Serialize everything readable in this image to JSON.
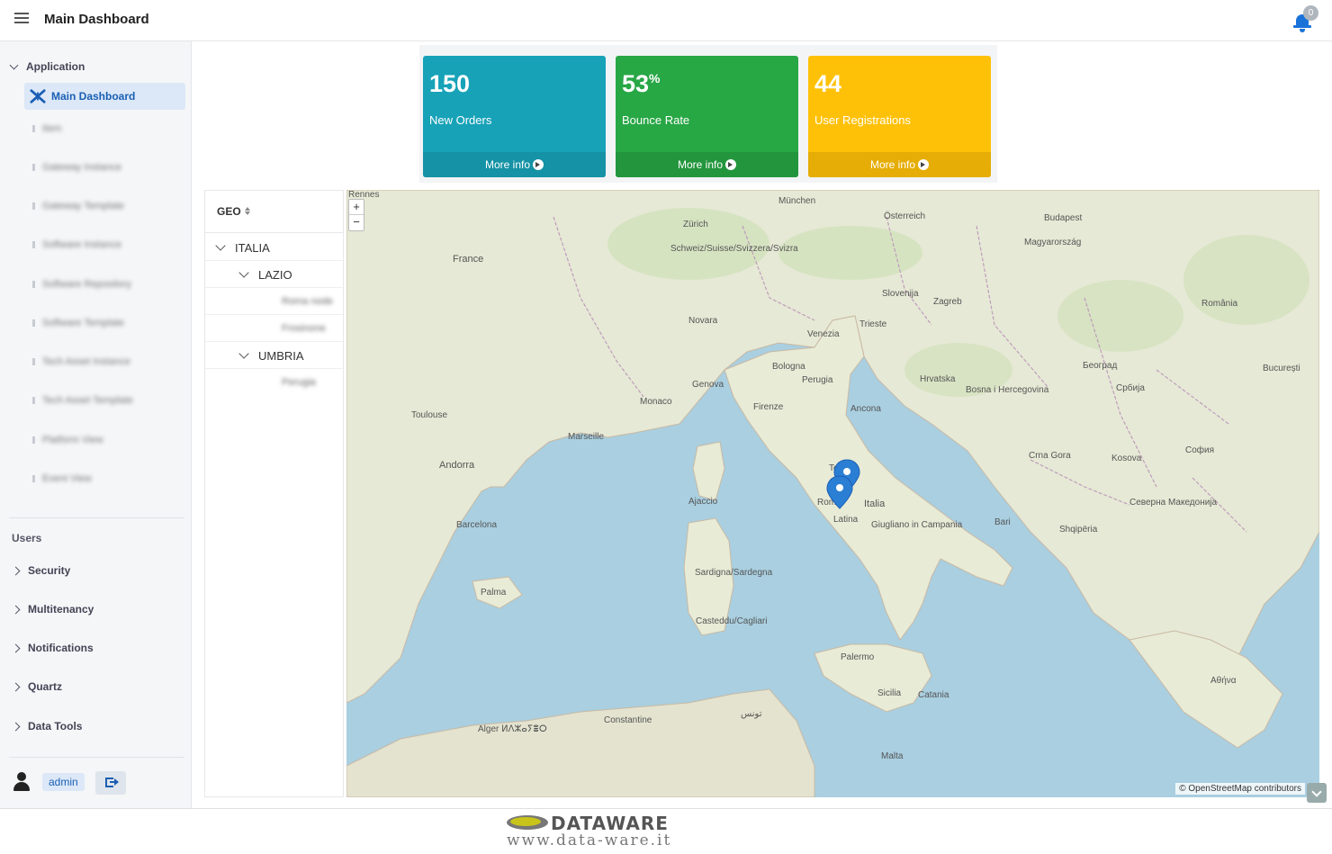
{
  "header": {
    "title": "Main Dashboard",
    "notification_count": "0"
  },
  "sidebar": {
    "application_label": "Application",
    "active_item": "Main Dashboard",
    "blurred_items": [
      "Item",
      "Gateway Instance",
      "Gateway Template",
      "Software Instance",
      "Software Repository",
      "Software Template",
      "Tech Asset Instance",
      "Tech Asset Template",
      "Platform View",
      "Event View"
    ],
    "users_label": "Users",
    "sections": [
      "Security",
      "Multitenancy",
      "Notifications",
      "Quartz",
      "Data Tools"
    ],
    "user_name": "admin"
  },
  "cards": [
    {
      "value": "150",
      "suffix": "",
      "label": "New Orders",
      "more": "More info",
      "color": "#17a2b8",
      "footer_color": "#1592a5"
    },
    {
      "value": "53",
      "suffix": "%",
      "label": "Bounce Rate",
      "more": "More info",
      "color": "#28a745",
      "footer_color": "#23963d"
    },
    {
      "value": "44",
      "suffix": "",
      "label": "User Registrations",
      "more": "More info",
      "color": "#ffc107",
      "footer_color": "#e6ad06"
    }
  ],
  "geo": {
    "header": "GEO",
    "rows": [
      {
        "label": "ITALIA",
        "level": 0,
        "expanded": true
      },
      {
        "label": "LAZIO",
        "level": 1,
        "expanded": true
      },
      {
        "label": "Roma node",
        "level": 2,
        "blurred": true
      },
      {
        "label": "Frosinone",
        "level": 2,
        "blurred": true
      },
      {
        "label": "UMBRIA",
        "level": 1,
        "expanded": true
      },
      {
        "label": "Perugia",
        "level": 2,
        "blurred": true
      }
    ]
  },
  "map": {
    "zoom_in": "+",
    "zoom_out": "−",
    "attribution": "© OpenStreetMap contributors",
    "labels": {
      "france": "France",
      "italia": "Italia",
      "roma": "Roma",
      "napoli": "Giugliano in Campania",
      "firenze": "Firenze",
      "bologna": "Bologna",
      "milano": "Novara",
      "venezia": "Venezia",
      "genova": "Genova",
      "monaco": "Monaco",
      "marseille": "Marseille",
      "andorra": "Andorra",
      "barcelona": "Barcelona",
      "palma": "Palma",
      "zagreb": "Zagreb",
      "budapest": "Budapest",
      "palermo": "Palermo",
      "bari": "Bari",
      "ajaccio": "Ajaccio",
      "malta": "Malta",
      "alger": "Alger ⵍⴷⵣⴰⵢⴻⵔ",
      "tunis": "تونس",
      "sofia": "София",
      "athens": "Αθήνα",
      "schweiz": "Schweiz/Suisse/Svizzera/Svizra",
      "osterreich": "Österreich",
      "slovenija": "Slovenija",
      "hrvatska": "Hrvatska",
      "srbija": "Србија",
      "romania": "România",
      "magyar": "Magyarország",
      "sardegna": "Sardigna/Sardegna",
      "sicilia": "Sicilia",
      "catania": "Catania",
      "toulouse": "Toulouse",
      "perugia": "Perugia",
      "ancona": "Ancona",
      "trieste": "Trieste",
      "zurich": "Zürich",
      "munchen": "München",
      "cagliari": "Casteddu/Cagliari",
      "constantine": "Constantine",
      "shqiperia": "Shqipëria",
      "beograd": "Београд",
      "bucuresti": "București",
      "kosova": "Kosova",
      "bosna": "Bosna i Hercegovina",
      "makedonija": "Северна Македонија",
      "crna_gora": "Crna Gora",
      "latina": "Latina",
      "rennes": "Rennes",
      "rieti": "Terni"
    }
  },
  "footer": {
    "brand": "DATAWARE",
    "url": "www.data-ware.it"
  }
}
